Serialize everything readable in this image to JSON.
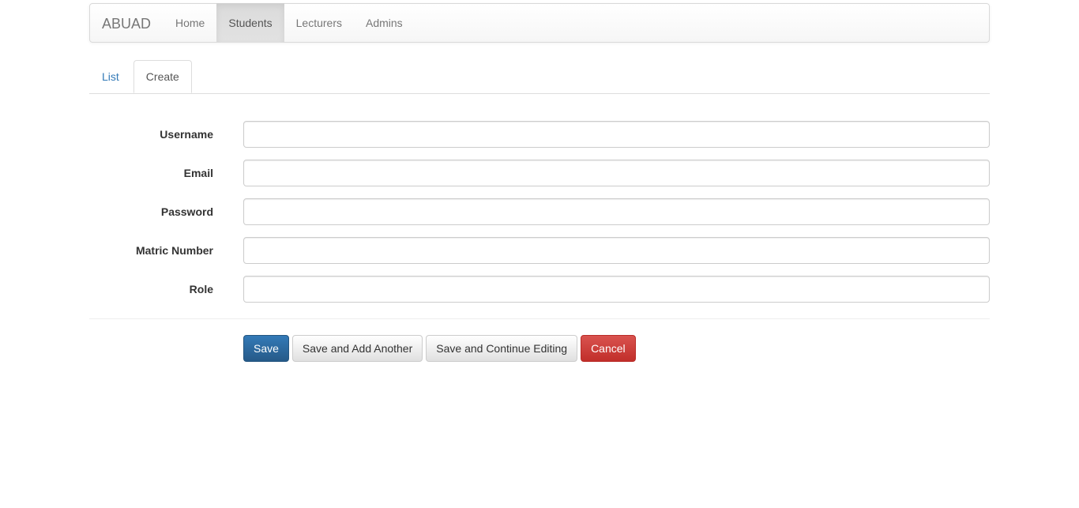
{
  "navbar": {
    "brand": "ABUAD",
    "items": [
      {
        "label": "Home"
      },
      {
        "label": "Students",
        "active": true
      },
      {
        "label": "Lecturers"
      },
      {
        "label": "Admins"
      }
    ]
  },
  "tabs": [
    {
      "label": "List"
    },
    {
      "label": "Create",
      "active": true
    }
  ],
  "form": {
    "fields": [
      {
        "label": "Username",
        "value": "",
        "placeholder": ""
      },
      {
        "label": "Email",
        "value": "",
        "placeholder": ""
      },
      {
        "label": "Password",
        "value": "",
        "placeholder": ""
      },
      {
        "label": "Matric Number",
        "value": "",
        "placeholder": ""
      },
      {
        "label": "Role",
        "value": "",
        "placeholder": ""
      }
    ]
  },
  "actions": {
    "save_label": "Save",
    "save_add_label": "Save and Add Another",
    "save_continue_label": "Save and Continue Editing",
    "cancel_label": "Cancel"
  },
  "colors": {
    "primary": "#337ab7",
    "danger": "#d9534f",
    "link": "#337ab7"
  }
}
